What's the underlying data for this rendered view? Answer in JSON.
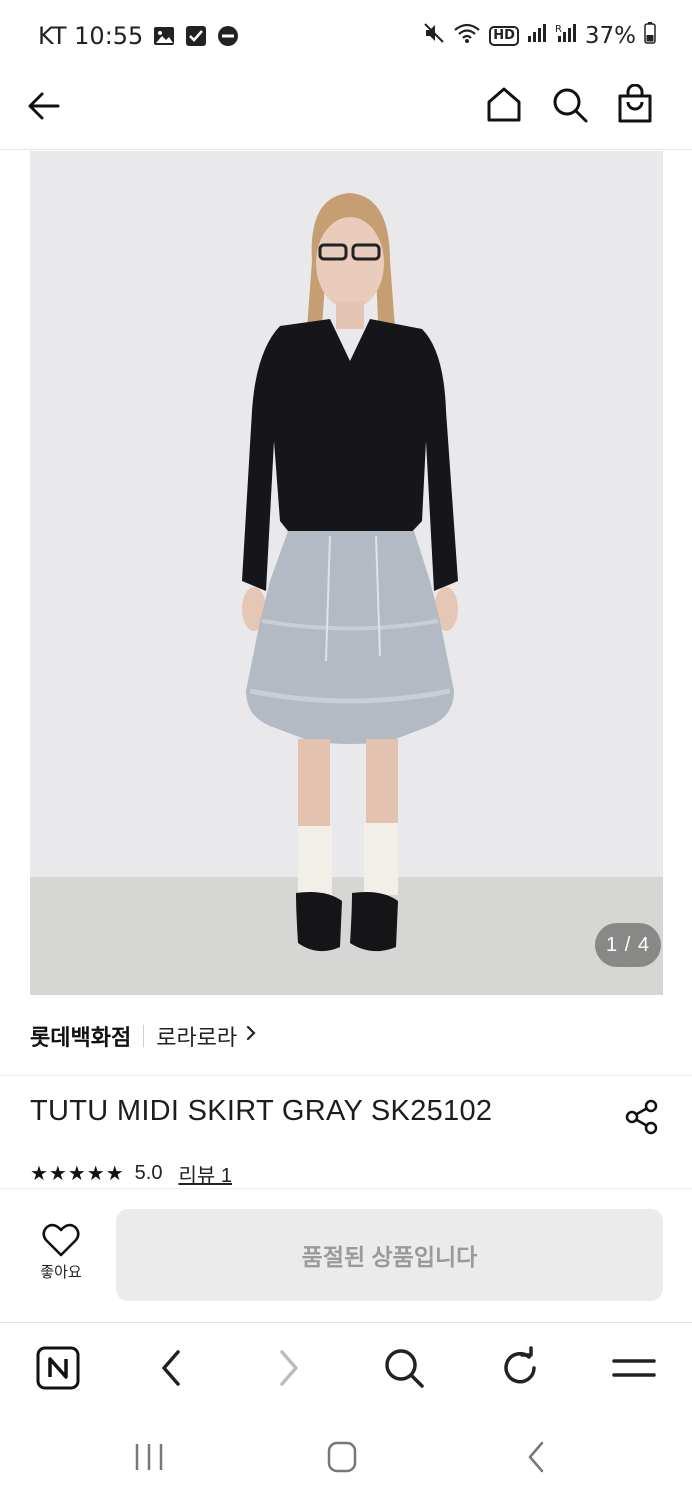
{
  "status_bar": {
    "carrier_time": "KT 10:55",
    "battery": "37%",
    "network_badge": "HD",
    "icons_left": [
      "gallery-icon",
      "check-box-icon",
      "do-not-disturb-icon"
    ],
    "icons_right": [
      "mute-icon",
      "wifi-icon",
      "hd-badge",
      "signal-icon",
      "roaming-signal-icon",
      "battery-icon"
    ]
  },
  "header": {
    "icons": [
      "back-arrow-icon",
      "home-icon",
      "search-icon",
      "shopping-bag-icon"
    ]
  },
  "gallery": {
    "counter": "1 / 4",
    "current": 1,
    "total": 4
  },
  "product": {
    "store": "롯데백화점",
    "brand": "로라로라",
    "title": "TUTU MIDI SKIRT GRAY SK25102",
    "stars": "★★★★★",
    "rating": "5.0",
    "review_link": "리뷰 1"
  },
  "actions": {
    "like_label": "좋아요",
    "soldout_label": "품절된 상품입니다"
  },
  "browser_bar": {
    "items": [
      "naver-n-icon",
      "browser-back-icon",
      "browser-forward-icon",
      "browser-search-icon",
      "refresh-icon",
      "menu-icon"
    ]
  },
  "system_nav": {
    "items": [
      "recent-apps-icon",
      "home-button-icon",
      "system-back-icon"
    ]
  },
  "colors": {
    "text": "#111111",
    "soldout_bg": "#ebebeb",
    "soldout_text": "#9a9a9a",
    "divider": "#ececec",
    "disabled_icon": "#bdbdbd"
  }
}
